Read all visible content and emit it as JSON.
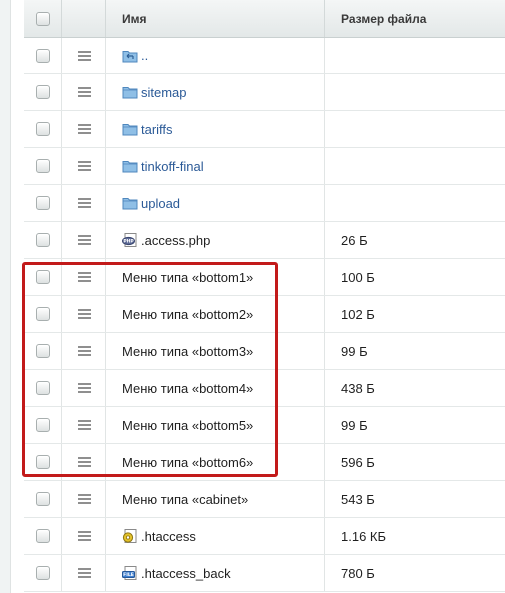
{
  "header": {
    "name_label": "Имя",
    "size_label": "Размер файла"
  },
  "rows": [
    {
      "name": "..",
      "size": "",
      "icon": "folder-up-icon",
      "kind": "link"
    },
    {
      "name": "sitemap",
      "size": "",
      "icon": "folder-icon",
      "kind": "link"
    },
    {
      "name": "tariffs",
      "size": "",
      "icon": "folder-icon",
      "kind": "link"
    },
    {
      "name": "tinkoff-final",
      "size": "",
      "icon": "folder-icon",
      "kind": "link"
    },
    {
      "name": "upload",
      "size": "",
      "icon": "folder-icon",
      "kind": "link"
    },
    {
      "name": ".access.php",
      "size": "26 Б",
      "icon": "php-file-icon",
      "kind": "plain"
    },
    {
      "name": "Меню типа «bottom1»",
      "size": "100 Б",
      "icon": "",
      "kind": "plain"
    },
    {
      "name": "Меню типа «bottom2»",
      "size": "102 Б",
      "icon": "",
      "kind": "plain"
    },
    {
      "name": "Меню типа «bottom3»",
      "size": "99 Б",
      "icon": "",
      "kind": "plain"
    },
    {
      "name": "Меню типа «bottom4»",
      "size": "438 Б",
      "icon": "",
      "kind": "plain"
    },
    {
      "name": "Меню типа «bottom5»",
      "size": "99 Б",
      "icon": "",
      "kind": "plain"
    },
    {
      "name": "Меню типа «bottom6»",
      "size": "596 Б",
      "icon": "",
      "kind": "plain"
    },
    {
      "name": "Меню типа «cabinet»",
      "size": "543 Б",
      "icon": "",
      "kind": "plain"
    },
    {
      "name": ".htaccess",
      "size": "1.16 КБ",
      "icon": "settings-file-icon",
      "kind": "plain"
    },
    {
      "name": ".htaccess_back",
      "size": "780 Б",
      "icon": "generic-file-icon",
      "kind": "plain"
    }
  ],
  "colors": {
    "link": "#2b5a97",
    "highlight_frame": "#c21a1a",
    "folder": "#7fb1dc"
  }
}
